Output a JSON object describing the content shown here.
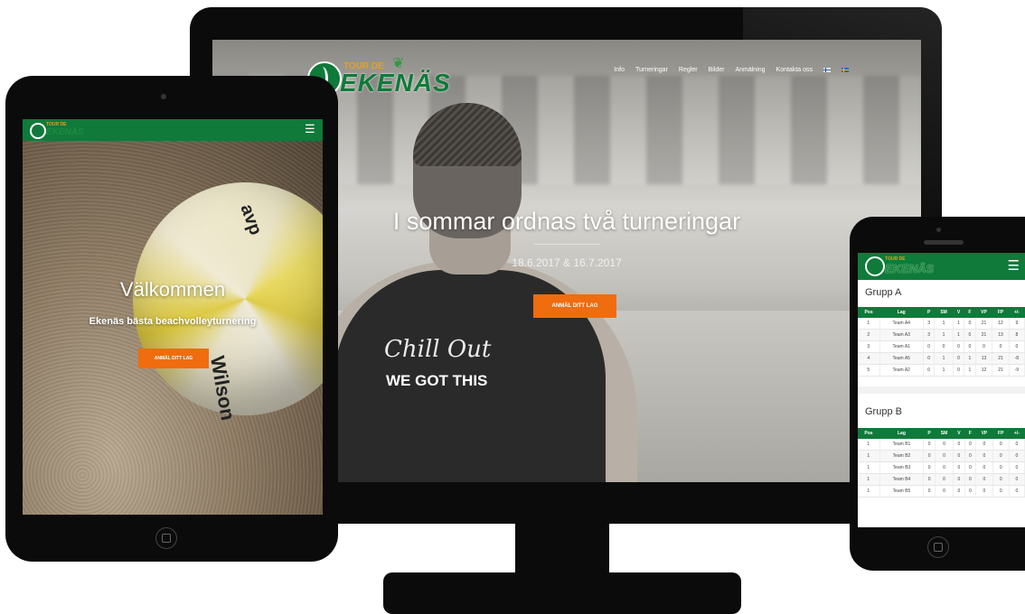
{
  "brand": {
    "logo_small": "TOUR DE",
    "logo_big": "EKENÄS"
  },
  "desktop": {
    "nav": [
      "Info",
      "Turneringar",
      "Regler",
      "Bilder",
      "Anmälning",
      "Kontakta oss"
    ],
    "hero_title": "I sommar ordnas två turneringar",
    "hero_dates": "18.6.2017 & 16.7.2017",
    "cta_label": "ANMÄL DITT LAG",
    "shirt_text_1": "Chill Out",
    "shirt_text_2": "WE GOT THIS"
  },
  "tablet": {
    "title": "Välkommen",
    "subtitle": "Ekenäs bästa beachvolleyturnering",
    "cta_label": "ANMÄL DITT LAG",
    "ball_text_1": "avp",
    "ball_text_2": "Wilson"
  },
  "phone": {
    "columns": [
      "Pos",
      "Lag",
      "P",
      "SM",
      "V",
      "F",
      "VP",
      "FP",
      "+/-"
    ],
    "groups": [
      {
        "title": "Grupp A",
        "rows": [
          [
            "1",
            "Team A4",
            "3",
            "1",
            "1",
            "0",
            "21",
            "12",
            "9"
          ],
          [
            "2",
            "Team A3",
            "3",
            "1",
            "1",
            "0",
            "21",
            "13",
            "8"
          ],
          [
            "3",
            "Team A1",
            "0",
            "0",
            "0",
            "0",
            "0",
            "0",
            "0"
          ],
          [
            "4",
            "Team A5",
            "0",
            "1",
            "0",
            "1",
            "13",
            "21",
            "-8"
          ],
          [
            "5",
            "Team A2",
            "0",
            "1",
            "0",
            "1",
            "12",
            "21",
            "-9"
          ]
        ]
      },
      {
        "title": "Grupp B",
        "rows": [
          [
            "1",
            "Team B1",
            "0",
            "0",
            "0",
            "0",
            "0",
            "0",
            "0"
          ],
          [
            "1",
            "Team B2",
            "0",
            "0",
            "0",
            "0",
            "0",
            "0",
            "0"
          ],
          [
            "1",
            "Team B3",
            "0",
            "0",
            "0",
            "0",
            "0",
            "0",
            "0"
          ],
          [
            "1",
            "Team B4",
            "0",
            "0",
            "0",
            "0",
            "0",
            "0",
            "0"
          ],
          [
            "1",
            "Team B5",
            "0",
            "0",
            "0",
            "0",
            "0",
            "0",
            "0"
          ]
        ]
      }
    ]
  },
  "colors": {
    "brand_green": "#0f7a3a",
    "accent_orange": "#ef6c0f",
    "logo_gold": "#e8a020"
  }
}
